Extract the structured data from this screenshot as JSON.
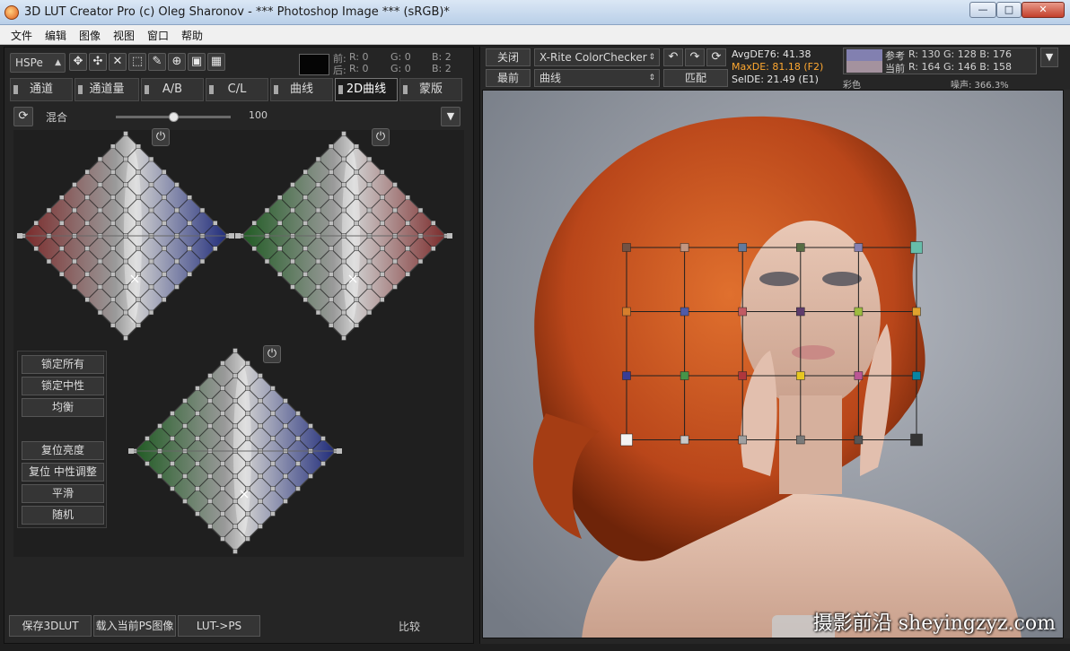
{
  "window": {
    "title": "3D LUT Creator Pro (c) Oleg Sharonov - *** Photoshop Image *** (sRGB)*",
    "minimize": "—",
    "maximize": "□",
    "close": "✕"
  },
  "menu": [
    "文件",
    "编辑",
    "图像",
    "视图",
    "窗口",
    "帮助"
  ],
  "left": {
    "color_space": "HSPe",
    "tool_icons": [
      "move-icon",
      "pan-icon",
      "transform-icon",
      "select-rect-icon",
      "eyedropper-icon",
      "zoom-icon",
      "fit-icon",
      "grid-icon"
    ],
    "readout": {
      "before_label": "前:",
      "after_label": "后:",
      "before": {
        "R": "R: 0",
        "G": "G: 0",
        "B": "B: 2"
      },
      "after": {
        "R": "R: 0",
        "G": "G: 0",
        "B": "B: 2"
      }
    },
    "tabs": [
      {
        "label": "通道"
      },
      {
        "label": "通道量"
      },
      {
        "label": "A/B"
      },
      {
        "label": "C/L"
      },
      {
        "label": "曲线"
      },
      {
        "label": "2D曲线"
      },
      {
        "label": "蒙版"
      }
    ],
    "active_tab": "2D曲线",
    "mix_label": "混合",
    "mix_value": "100",
    "mix_level": 100,
    "side_buttons": [
      "锁定所有",
      "锁定中性",
      "均衡",
      "复位亮度",
      "复位 中性调整",
      "平滑",
      "随机"
    ],
    "bottom_buttons": [
      "保存3DLUT",
      "载入当前PS图像",
      "LUT->PS"
    ],
    "compare_label": "比较"
  },
  "right": {
    "close_btn": "关闭",
    "recent_btn": "最前",
    "checker_select": "X-Rite ColorChecker",
    "curve_select": "曲线",
    "match_btn": "匹配",
    "avg_de": "AvgDE76: 41.38",
    "max_de": "MaxDE: 81.18 (F2)",
    "sel_de": "SelDE: 21.49 (E1)",
    "ref_label": "参考",
    "cur_label": "当前",
    "ref_rgb": "R: 130   G: 128   B: 176",
    "cur_rgb": "R: 164   G: 146   B: 158",
    "color_label": "彩色",
    "noise_label": "噪声: 366.3%",
    "ref_color": "#8280b0",
    "cur_color": "#a4929e",
    "watermark": "摄影前沿 sheyingzyz.com"
  },
  "colors": {
    "accent_orange": "#ffa830",
    "checker_patches": [
      [
        "#735244",
        "#c29682",
        "#627a9d",
        "#576c43",
        "#8580b1",
        "#67bdaa"
      ],
      [
        "#d67e2c",
        "#505ba6",
        "#c15a63",
        "#5e3c6c",
        "#9dbc40",
        "#e0a32e"
      ],
      [
        "#383d96",
        "#469449",
        "#af363c",
        "#e7c71f",
        "#bb5695",
        "#0885a1"
      ],
      [
        "#f3f3f2",
        "#c8c8c8",
        "#a0a0a0",
        "#7a7a79",
        "#555555",
        "#343434"
      ]
    ]
  }
}
